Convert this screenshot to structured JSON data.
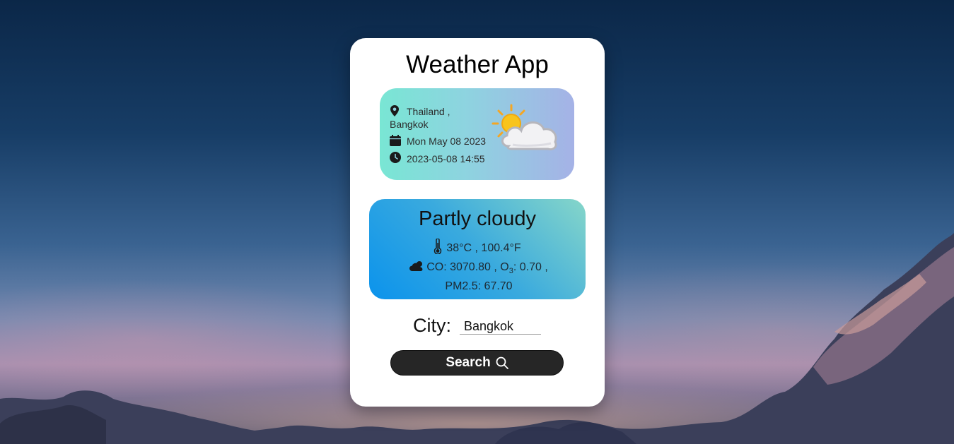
{
  "app": {
    "title": "Weather App"
  },
  "location": {
    "country": "Thailand ,",
    "city": "Bangkok",
    "date": "Mon May 08 2023",
    "datetime": "2023-05-08 14:55",
    "icon": "map-pin-icon"
  },
  "weather_icon": "sun-behind-cloud",
  "condition": {
    "title": "Partly cloudy",
    "temperature": "38°C , 100.4°F",
    "air_quality_line1_prefix": "CO: 3070.80 , O",
    "air_quality_line1_sub": "3",
    "air_quality_line1_suffix": ": 0.70 ,",
    "air_quality_line2": "PM2.5: 67.70"
  },
  "search": {
    "label": "City:",
    "value": "Bangkok",
    "button_label": "Search"
  },
  "colors": {
    "button": "#262626",
    "info_gradient_start": "#79e6d4",
    "info_gradient_end": "#a5b2e6",
    "condition_gradient_start": "#0b93ec",
    "condition_gradient_end": "#86d6c9"
  }
}
